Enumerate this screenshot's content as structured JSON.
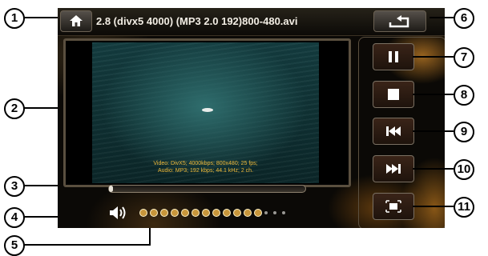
{
  "file_title": "2.8 (divx5 4000) (MP3 2.0 192)800-480.avi",
  "video_info": {
    "line1": "Video: DivX5; 4000kbps; 800x480; 25 fps;",
    "line2": "Audio: MP3; 192 kbps; 44.1 kHz; 2 ch."
  },
  "progress_value": 0.0,
  "volume": {
    "level": 12,
    "max": 15
  },
  "controls": {
    "home": "home-icon",
    "repeat": "repeat-icon",
    "pause": "pause-icon",
    "stop": "stop-icon",
    "previous": "previous-icon",
    "next": "next-icon",
    "fullscreen": "fullscreen-icon"
  },
  "callouts": [
    "1",
    "2",
    "3",
    "4",
    "5",
    "6",
    "7",
    "8",
    "9",
    "10",
    "11"
  ],
  "colors": {
    "accent": "#c8963b",
    "info_text": "#f0b93a",
    "button_bg": "#2a1a10"
  }
}
